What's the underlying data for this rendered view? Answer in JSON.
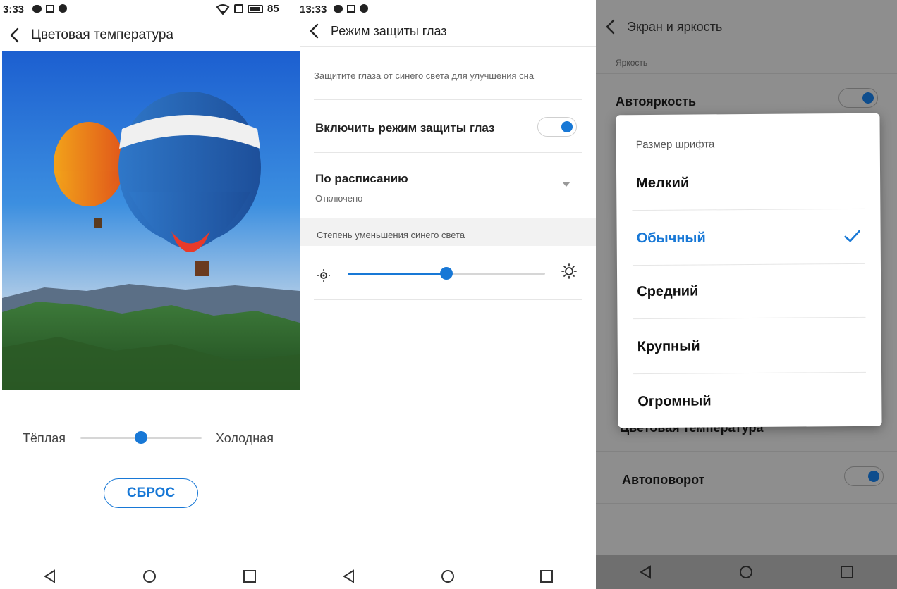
{
  "panel1": {
    "status": {
      "time": "3:33",
      "battery": "85"
    },
    "title": "Цветовая температура",
    "slider": {
      "left_label": "Тёплая",
      "right_label": "Холодная",
      "position": 0.5
    },
    "reset_label": "СБРОС"
  },
  "panel2": {
    "status": {
      "time": "13:33"
    },
    "title": "Режим защиты глаз",
    "description": "Защитите глаза от синего света для улучшения сна",
    "toggle_label": "Включить режим защиты глаз",
    "toggle_on": true,
    "schedule": {
      "title": "По расписанию",
      "value": "Отключено"
    },
    "section_title": "Степень уменьшения синего света",
    "slider_position": 0.5
  },
  "panel3": {
    "title": "Экран и яркость",
    "section": "Яркость",
    "items": {
      "auto_brightness": "Автояркость",
      "color_temperature": "Цветовая температура",
      "auto_rotate": "Автоповорот"
    },
    "dialog": {
      "title": "Размер шрифта",
      "options": [
        "Мелкий",
        "Обычный",
        "Средний",
        "Крупный",
        "Огромный"
      ],
      "selected_index": 1
    }
  },
  "colors": {
    "accent": "#1878d6"
  }
}
